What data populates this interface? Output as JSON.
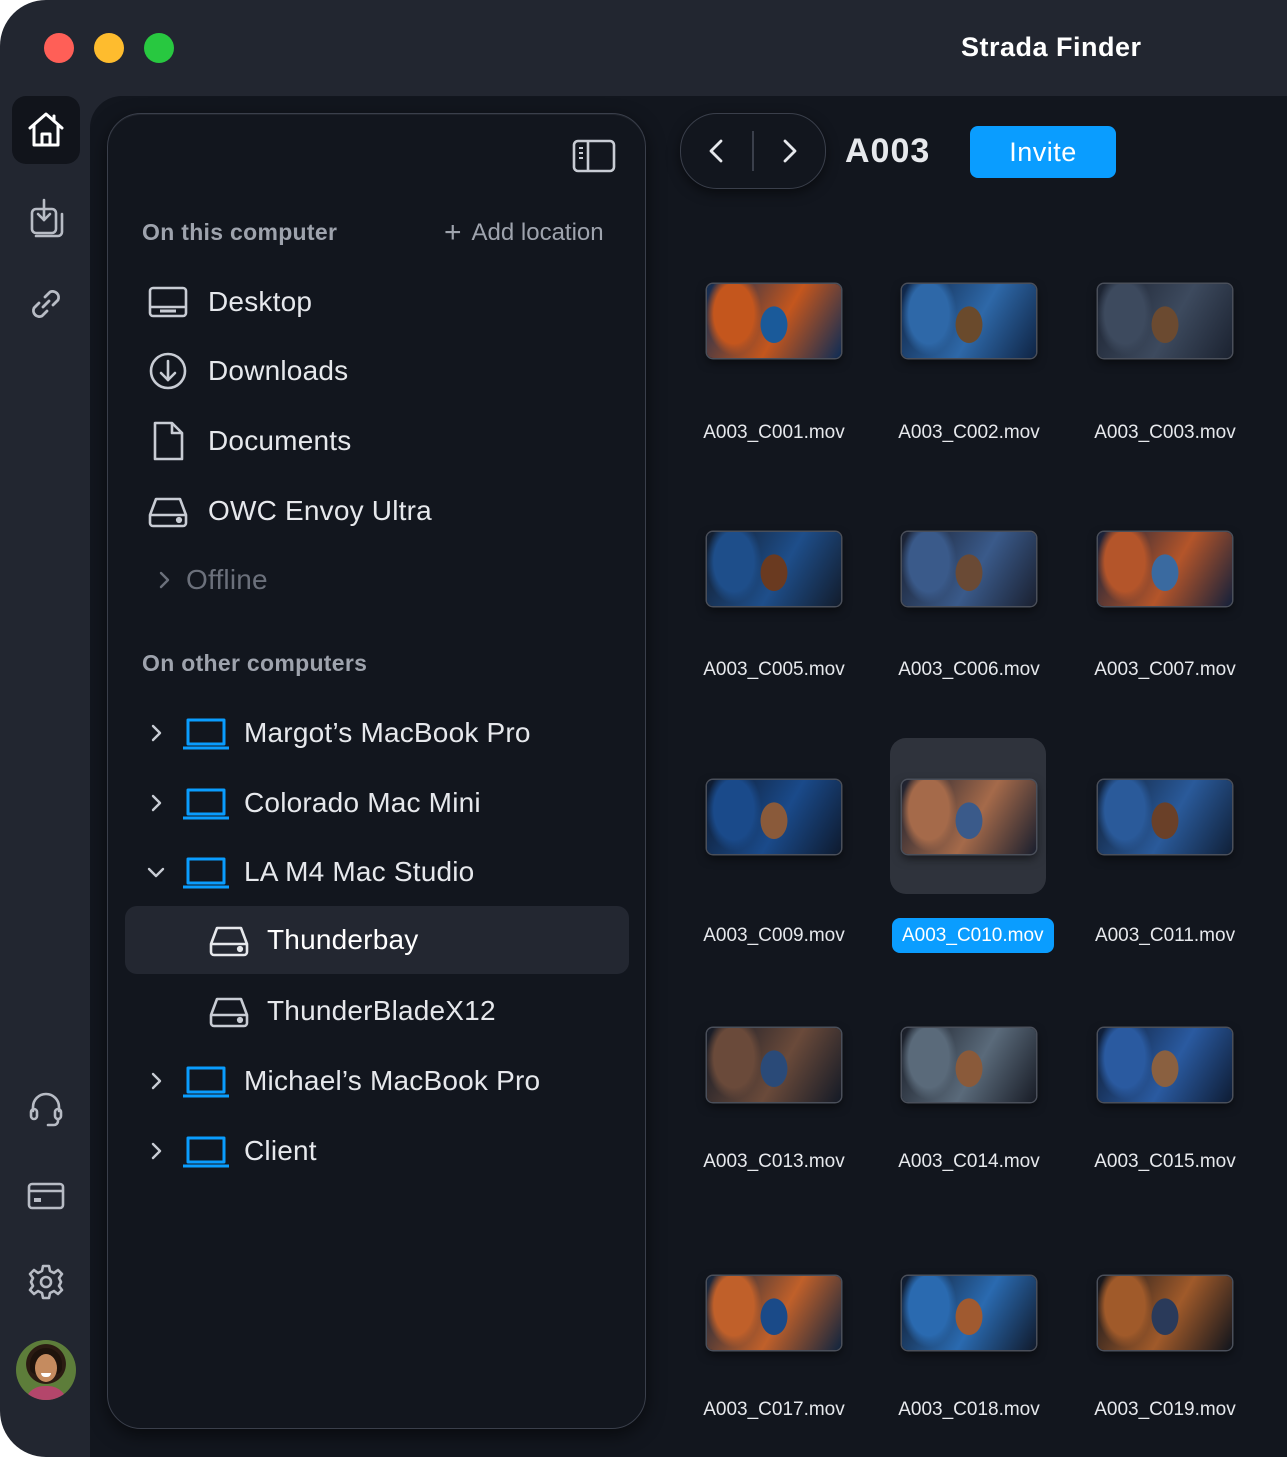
{
  "window": {
    "title": "Strada Finder"
  },
  "rail": {
    "items": [
      {
        "name": "home-icon"
      },
      {
        "name": "import-icon"
      },
      {
        "name": "link-icon"
      },
      {
        "name": "support-headset-icon"
      },
      {
        "name": "billing-card-icon"
      },
      {
        "name": "settings-gear-icon"
      }
    ]
  },
  "sidebar": {
    "section_local": "On this computer",
    "add_location": "Add location",
    "local_items": [
      {
        "label": "Desktop",
        "icon": "desktop-icon"
      },
      {
        "label": "Downloads",
        "icon": "download-circle-icon"
      },
      {
        "label": "Documents",
        "icon": "document-icon"
      },
      {
        "label": "OWC Envoy Ultra",
        "icon": "drive-icon"
      }
    ],
    "offline_label": "Offline",
    "section_remote": "On other computers",
    "remote_items": [
      {
        "label": "Margot’s MacBook Pro",
        "expanded": false
      },
      {
        "label": "Colorado Mac Mini",
        "expanded": false
      },
      {
        "label": "LA M4 Mac Studio",
        "expanded": true
      },
      {
        "label": "Thunderbay",
        "child": true,
        "selected": true
      },
      {
        "label": "ThunderBladeX12",
        "child": true
      },
      {
        "label": "Michael’s MacBook Pro",
        "expanded": false
      },
      {
        "label": "Client",
        "expanded": false
      }
    ]
  },
  "toolbar": {
    "folder_title": "A003",
    "invite_label": "Invite"
  },
  "files": [
    "A003_C001.mov",
    "A003_C002.mov",
    "A003_C003.mov",
    "A003_C005.mov",
    "A003_C006.mov",
    "A003_C007.mov",
    "A003_C009.mov",
    "A003_C010.mov",
    "A003_C011.mov",
    "A003_C013.mov",
    "A003_C014.mov",
    "A003_C015.mov",
    "A003_C017.mov",
    "A003_C018.mov",
    "A003_C019.mov"
  ],
  "selected_file": "A003_C010.mov",
  "colors": {
    "accent": "#0a9dff",
    "background": "#12161e",
    "chrome": "#222630"
  }
}
